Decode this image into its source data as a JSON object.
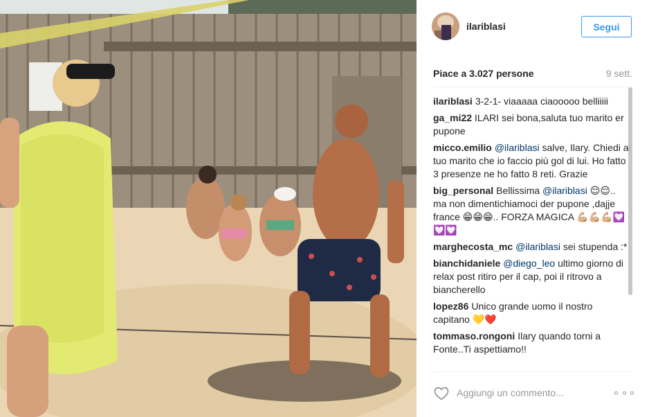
{
  "header": {
    "username": "ilariblasi",
    "follow_label": "Segui"
  },
  "post": {
    "likes_text": "Piace a 3.027 persone",
    "time_ago": "9 sett."
  },
  "comments": [
    {
      "author": "ilariblasi",
      "parts": [
        {
          "text": "3-2-1- viaaaaa ciaooooo belliiiii"
        }
      ]
    },
    {
      "author": "ga_mi22",
      "parts": [
        {
          "text": "ILARI sei bona,saluta tuo marito er pupone"
        }
      ]
    },
    {
      "author": "micco.emilio",
      "parts": [
        {
          "mention": "@ilariblasi"
        },
        {
          "text": " salve, Ilary. Chiedi al tuo marito che io faccio più gol di lui. Ho fatto 3 presenze ne ho fatto 8 reti. Grazie"
        }
      ]
    },
    {
      "author": "big_personal",
      "parts": [
        {
          "text": "Bellissima "
        },
        {
          "mention": "@ilariblasi"
        },
        {
          "text": " 😌😌.. ma non dimentichiamoci der pupone ,dajje france 😁😁😁.. FORZA MAGICA 💪🏼💪🏼💪🏼💟💟💟"
        }
      ]
    },
    {
      "author": "marghecosta_mc",
      "parts": [
        {
          "mention": "@ilariblasi"
        },
        {
          "text": " sei stupenda :*"
        }
      ]
    },
    {
      "author": "bianchidaniele",
      "parts": [
        {
          "mention": "@diego_leo"
        },
        {
          "text": " ultimo giorno di relax post ritiro per il cap, poi il ritrovo a biancherello"
        }
      ]
    },
    {
      "author": "lopez86",
      "parts": [
        {
          "text": "Unico grande uomo il nostro capitano 💛❤️"
        }
      ]
    },
    {
      "author": "tommaso.rongoni",
      "parts": [
        {
          "text": "Ilary quando torni a Fonte..Ti aspettiamo!!"
        }
      ]
    }
  ],
  "footer": {
    "comment_placeholder": "Aggiungi un commento..."
  },
  "icons": {
    "heart": "heart-icon",
    "more": "more-options-icon"
  },
  "colors": {
    "follow": "#3897f0",
    "mention": "#003569",
    "muted": "#999999"
  }
}
